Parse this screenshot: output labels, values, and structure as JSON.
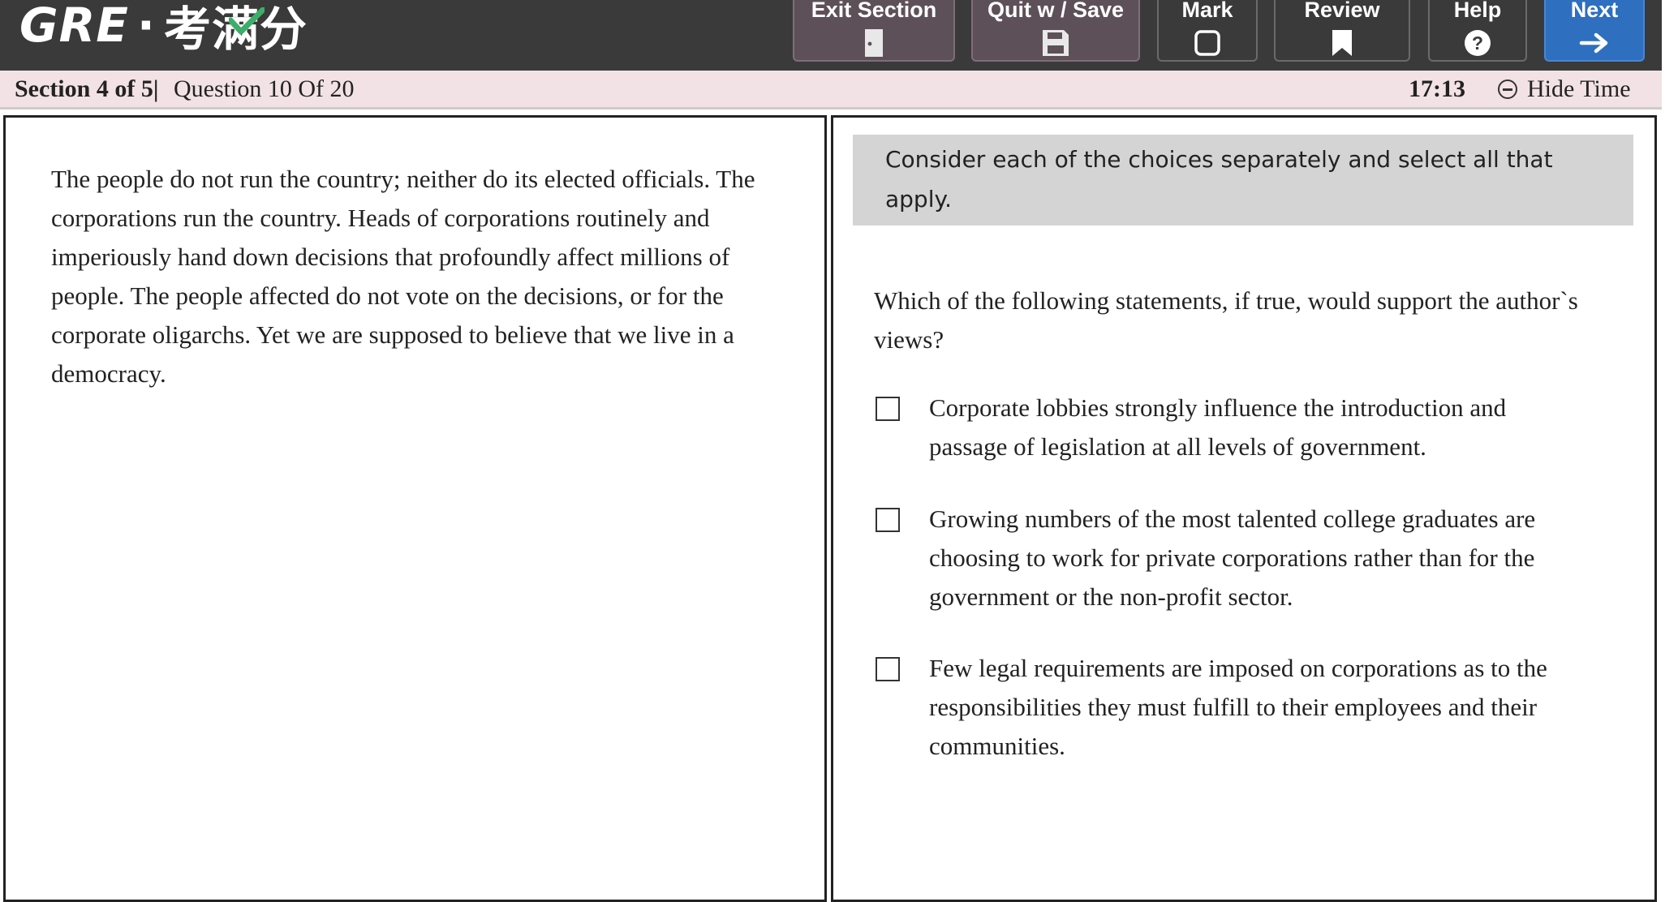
{
  "header": {
    "logo_latin": "GRE",
    "logo_dot": "·",
    "logo_cn": "考满分",
    "buttons": [
      {
        "label": "Exit Section",
        "icon": "door-icon"
      },
      {
        "label": "Quit w / Save",
        "icon": "save-icon"
      },
      {
        "label": "Mark",
        "icon": "checkbox-icon"
      },
      {
        "label": "Review",
        "icon": "bookmark-icon"
      },
      {
        "label": "Help",
        "icon": "question-icon"
      },
      {
        "label": "Next",
        "icon": "arrow-right-icon"
      }
    ]
  },
  "status": {
    "section": "Section 4 of 5|",
    "question": "Question 10 Of 20",
    "time": "17:13",
    "hide_time": "Hide Time"
  },
  "passage": "The people do not run the country; neither do its elected officials. The corporations run the country. Heads of corporations routinely and imperiously hand down decisions that profoundly affect millions of people. The people affected do not vote on the decisions, or for the corporate oligarchs. Yet we are supposed to believe that we live in a democracy.",
  "question": {
    "instruction": "Consider each of the choices separately and select all that apply.",
    "prompt": "Which of the following statements, if true, would support the author`s views?",
    "choices": [
      {
        "text": "Corporate lobbies strongly influence the introduction and passage of legislation at all levels of government.",
        "checked": false
      },
      {
        "text": "Growing numbers of the most talented college graduates are choosing to work for private corporations rather than for the government or the non-profit sector.",
        "checked": false
      },
      {
        "text": "Few legal requirements are imposed on corporations as to the responsibilities they must fulfill to their employees and their communities.",
        "checked": false
      }
    ]
  },
  "colors": {
    "topbar": "#3a3a3a",
    "statusbar": "#f2e2e6",
    "button": "#5e5058",
    "next_button": "#2e6fbf",
    "instruction_bg": "#d4d4d4",
    "logo_check": "#3cae6a"
  }
}
